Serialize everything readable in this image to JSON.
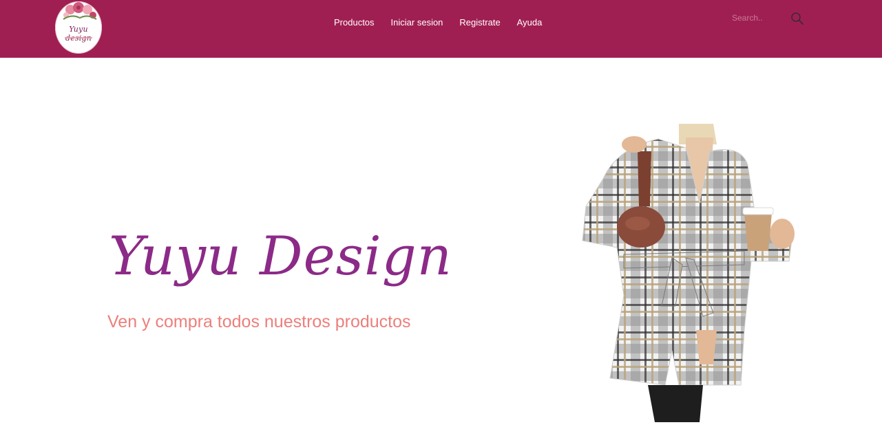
{
  "header": {
    "logo_text": "Yuyu design",
    "nav": [
      "Productos",
      "Iniciar sesion",
      "Registrate",
      "Ayuda"
    ],
    "search": {
      "placeholder": "Search..",
      "value": ""
    }
  },
  "hero": {
    "title": "Yuyu Design",
    "subtitle": "Ven y compra todos nuestros productos"
  },
  "colors": {
    "header_bg": "#a01f52",
    "title": "#8c2a88",
    "subtitle": "#ec7f7b"
  },
  "icons": [
    "search-icon"
  ]
}
